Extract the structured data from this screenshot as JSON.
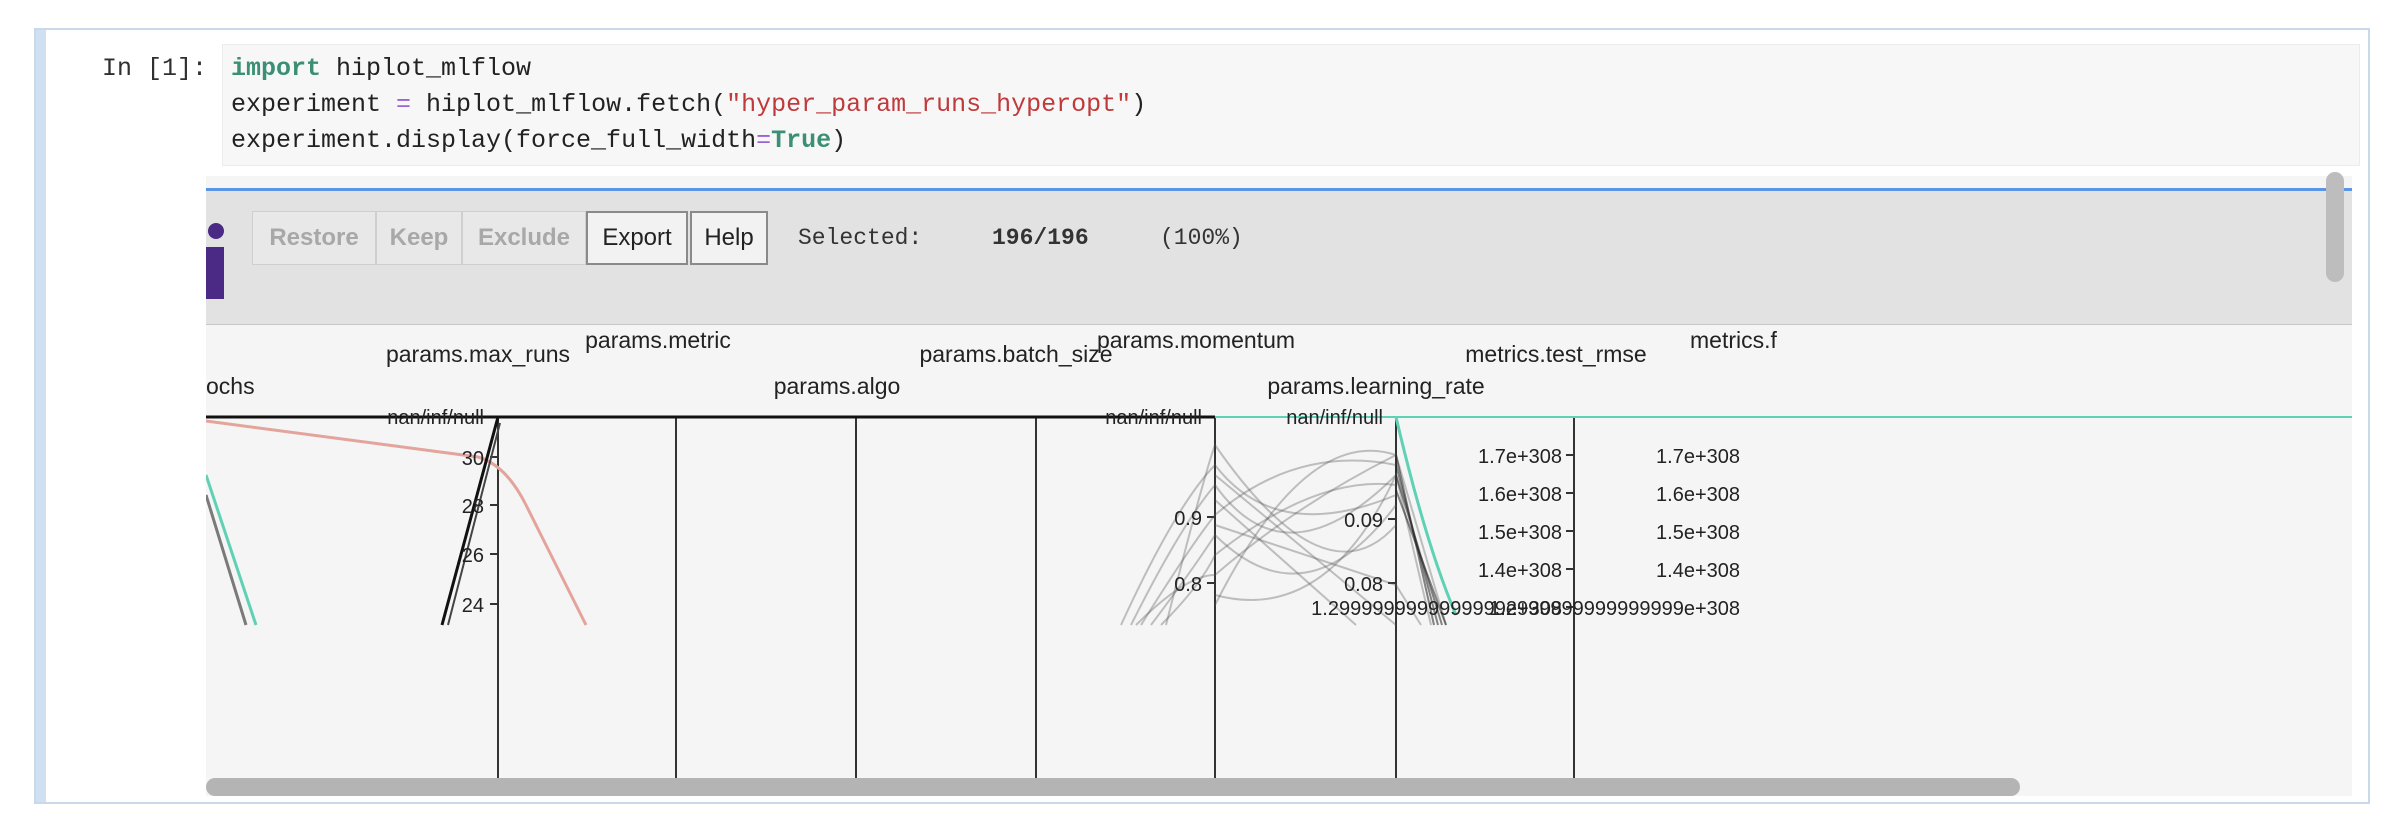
{
  "cell": {
    "prompt": "In [1]:",
    "code": {
      "line1_keyword": "import",
      "line1_rest": " hiplot_mlflow",
      "line2_a": "experiment ",
      "line2_eq": "=",
      "line2_b": " hiplot_mlflow.fetch(",
      "line2_str": "\"hyper_param_runs_hyperopt\"",
      "line2_c": ")",
      "line3_a": "experiment.display(force_full_width",
      "line3_eq": "=",
      "line3_true": "True",
      "line3_c": ")"
    }
  },
  "hiplot": {
    "toolbar": {
      "restore_label": "Restore",
      "keep_label": "Keep",
      "exclude_label": "Exclude",
      "export_label": "Export",
      "help_label": "Help",
      "selected_label": "Selected:",
      "selected_count": "196/196",
      "selected_pct": "(100%)"
    },
    "axes_labels": {
      "epochs": "ochs",
      "max_runs": "params.max_runs",
      "metric": "params.metric",
      "algo": "params.algo",
      "batch_size": "params.batch_size",
      "momentum": "params.momentum",
      "learning_rate": "params.learning_rate",
      "test_rmse": "metrics.test_rmse",
      "metrics_f": "metrics.f"
    },
    "ticks": {
      "nan": "nan/inf/null",
      "max_runs_30": "30",
      "max_runs_28": "28",
      "max_runs_26": "26",
      "max_runs_24": "24",
      "mom_09": "0.9",
      "mom_08": "0.8",
      "lr_009": "0.09",
      "lr_008": "0.08",
      "rmse_17": "1.7e+308",
      "rmse_16": "1.6e+308",
      "rmse_15": "1.5e+308",
      "rmse_14": "1.4e+308",
      "rmse_13": "1.2999999999999999e+308",
      "f_17": "1.7e+308",
      "f_16": "1.6e+308",
      "f_15": "1.5e+308",
      "f_14": "1.4e+308",
      "f_13": "1.2999999999999999e+308"
    },
    "colors": {
      "accent_top": "#5b95e6",
      "teal_line": "#5fd1b5",
      "pink_line": "#e3a49c",
      "logo": "#4b2a86"
    }
  }
}
